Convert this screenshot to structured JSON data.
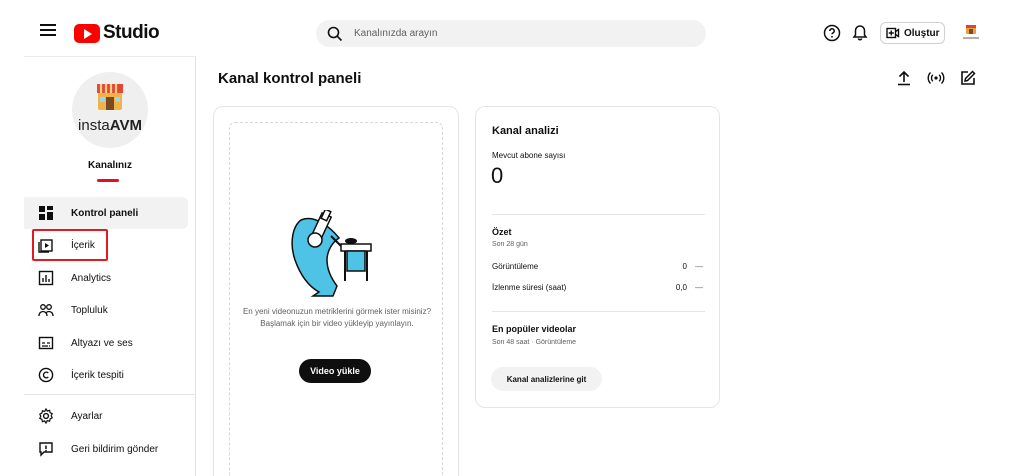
{
  "header": {
    "logo_text": "Studio",
    "search_placeholder": "Kanalınızda arayın",
    "create_label": "Oluştur",
    "icons": [
      "menu-icon",
      "help-icon",
      "bell-icon",
      "create-video-icon"
    ]
  },
  "sidebar": {
    "channel_brand_a": "insta",
    "channel_brand_b": "AVM",
    "channel_title": "Kanalınız",
    "items": [
      {
        "label": "Kontrol paneli",
        "icon": "dashboard-icon"
      },
      {
        "label": "İçerik",
        "icon": "content-icon"
      },
      {
        "label": "Analytics",
        "icon": "analytics-icon"
      },
      {
        "label": "Topluluk",
        "icon": "community-icon"
      },
      {
        "label": "Altyazı ve ses",
        "icon": "subtitles-icon"
      },
      {
        "label": "İçerik tespiti",
        "icon": "copyright-icon"
      },
      {
        "label": "Ayarlar",
        "icon": "settings-icon"
      },
      {
        "label": "Geri bildirim gönder",
        "icon": "feedback-icon"
      }
    ]
  },
  "main": {
    "title": "Kanal kontrol paneli",
    "actions": [
      "upload-icon",
      "live-icon",
      "edit-icon"
    ],
    "upload_card": {
      "text_line1": "En yeni videonuzun metriklerini görmek ister misiniz?",
      "text_line2": "Başlamak için bir video yükleyip yayınlayın.",
      "button": "Video yükle"
    },
    "analytics_card": {
      "title": "Kanal analizi",
      "subscribers_label": "Mevcut abone sayısı",
      "subscribers_value": "0",
      "summary_title": "Özet",
      "summary_period": "Son 28 gün",
      "metrics": [
        {
          "label": "Görüntüleme",
          "value": "0",
          "delta": "—"
        },
        {
          "label": "İzlenme süresi (saat)",
          "value": "0,0",
          "delta": "—"
        }
      ],
      "popular_title": "En popüler videolar",
      "popular_sub": "Son 48 saat · Görüntüleme",
      "button": "Kanal analizlerine git"
    }
  },
  "colors": {
    "brand_red": "#ff0000",
    "highlight": "#e01b24",
    "illustration_blue": "#4fc3e6"
  }
}
